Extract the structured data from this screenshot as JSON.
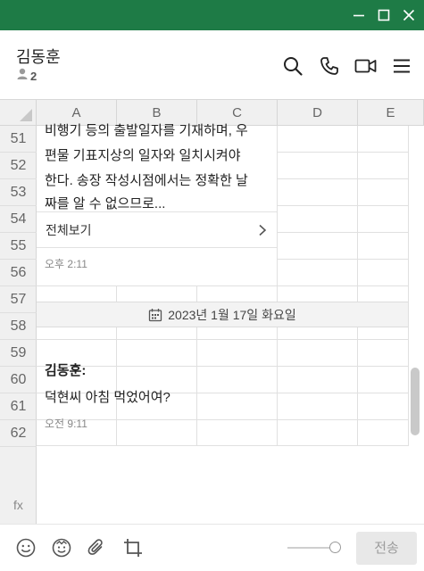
{
  "window": {
    "controls": [
      "minimize-icon",
      "maximize-icon",
      "close-icon"
    ],
    "titlebar_color": "#1e7b46"
  },
  "header": {
    "chat_name": "김동훈",
    "member_count": "2",
    "icons": [
      "search-icon",
      "phone-icon",
      "video-call-icon",
      "menu-icon"
    ]
  },
  "sheet": {
    "columns": [
      "A",
      "B",
      "C",
      "D",
      "E"
    ],
    "rows": [
      "51",
      "52",
      "53",
      "54",
      "55",
      "56",
      "57",
      "58",
      "59",
      "60",
      "61",
      "62"
    ],
    "formula_label": "fx"
  },
  "messages": {
    "long_message_lines": [
      "비행기 등의 출발일자를 기재하며, 우",
      "편물 기표지상의 일자와 일치시켜야",
      "한다. 송장 작성시점에서는 정확한 날",
      "짜를 알 수 없으므로..."
    ],
    "view_all": "전체보기",
    "time_1": "오후 2:11",
    "date_divider": "2023년 1월 17일 화요일",
    "sender": "김동훈:",
    "text": "덕현씨 아침 먹었어여?",
    "time_2": "오전 9:11"
  },
  "footer": {
    "icons": [
      "emoji-icon",
      "emoticon-icon",
      "attach-icon",
      "crop-icon"
    ],
    "send_label": "전송"
  }
}
